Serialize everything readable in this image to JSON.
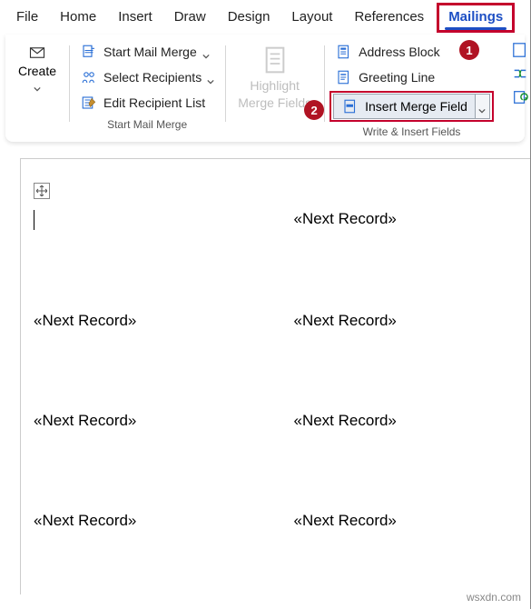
{
  "tabs": {
    "file": "File",
    "home": "Home",
    "insert": "Insert",
    "draw": "Draw",
    "design": "Design",
    "layout": "Layout",
    "references": "References",
    "mailings": "Mailings"
  },
  "callouts": {
    "one": "1",
    "two": "2"
  },
  "ribbon": {
    "create_group": {
      "create": "Create",
      "label": " "
    },
    "start_group": {
      "start_mail_merge": "Start Mail Merge",
      "select_recipients": "Select Recipients",
      "edit_recipient_list": "Edit Recipient List",
      "label": "Start Mail Merge"
    },
    "highlight_group": {
      "line1": "Highlight",
      "line2": "Merge Fields"
    },
    "write_group": {
      "address_block": "Address Block",
      "greeting_line": "Greeting Line",
      "insert_merge_field": "Insert Merge Field",
      "label": "Write & Insert Fields"
    }
  },
  "document": {
    "field_text": "«Next Record»"
  },
  "watermark": "wsxdn.com"
}
